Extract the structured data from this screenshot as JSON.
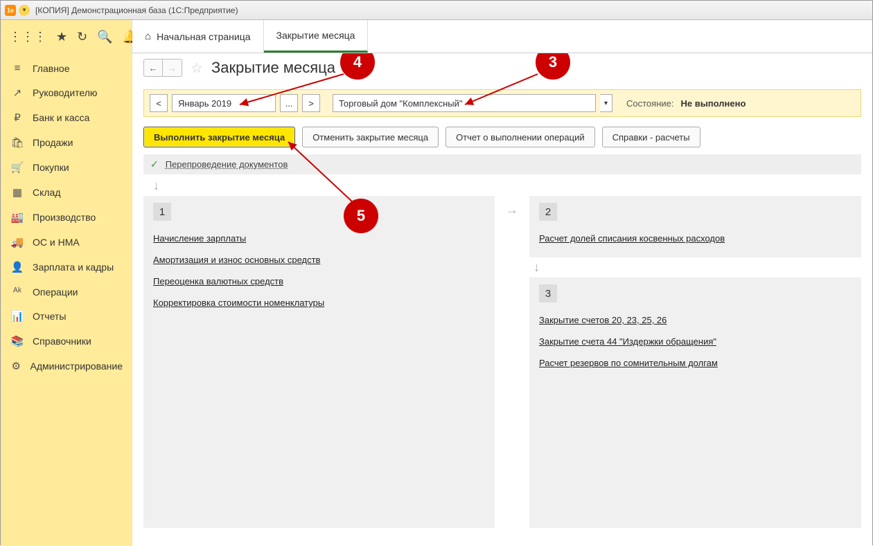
{
  "titlebar": {
    "text": "[КОПИЯ] Демонстрационная база  (1С:Предприятие)",
    "logo_text": "1e"
  },
  "tabs": {
    "home": "Начальная страница",
    "active": "Закрытие месяца"
  },
  "sidebar": {
    "items": [
      {
        "icon": "≡",
        "label": "Главное"
      },
      {
        "icon": "↗",
        "label": "Руководителю"
      },
      {
        "icon": "₽",
        "label": "Банк и касса"
      },
      {
        "icon": "🛍",
        "label": "Продажи"
      },
      {
        "icon": "🛒",
        "label": "Покупки"
      },
      {
        "icon": "▦",
        "label": "Склад"
      },
      {
        "icon": "🏭",
        "label": "Производство"
      },
      {
        "icon": "🚚",
        "label": "ОС и НМА"
      },
      {
        "icon": "👤",
        "label": "Зарплата и кадры"
      },
      {
        "icon": "ᴬᵏ",
        "label": "Операции"
      },
      {
        "icon": "📊",
        "label": "Отчеты"
      },
      {
        "icon": "📚",
        "label": "Справочники"
      },
      {
        "icon": "⚙",
        "label": "Администрирование"
      }
    ]
  },
  "page": {
    "title": "Закрытие месяца",
    "nav_prev": "←",
    "nav_next": "→"
  },
  "filter": {
    "prev": "<",
    "next": ">",
    "period": "Январь 2019",
    "ellipsis": "...",
    "org": "Торговый дом \"Комплексный\"",
    "status_label": "Состояние:",
    "status_value": "Не выполнено"
  },
  "actions": {
    "run": "Выполнить закрытие месяца",
    "cancel": "Отменить закрытие месяца",
    "report": "Отчет о выполнении операций",
    "calc": "Справки - расчеты"
  },
  "repost": {
    "label": "Перепроведение документов"
  },
  "sections": {
    "s1": {
      "num": "1",
      "ops": [
        "Начисление зарплаты",
        "Амортизация и износ основных средств",
        "Переоценка валютных средств",
        "Корректировка стоимости номенклатуры"
      ]
    },
    "s2": {
      "num": "2",
      "ops": [
        "Расчет долей списания косвенных расходов"
      ]
    },
    "s3": {
      "num": "3",
      "ops": [
        "Закрытие счетов 20, 23, 25, 26",
        "Закрытие счета 44 \"Издержки обращения\"",
        "Расчет резервов по сомнительным долгам"
      ]
    }
  },
  "callouts": {
    "c3": "3",
    "c4": "4",
    "c5": "5"
  }
}
